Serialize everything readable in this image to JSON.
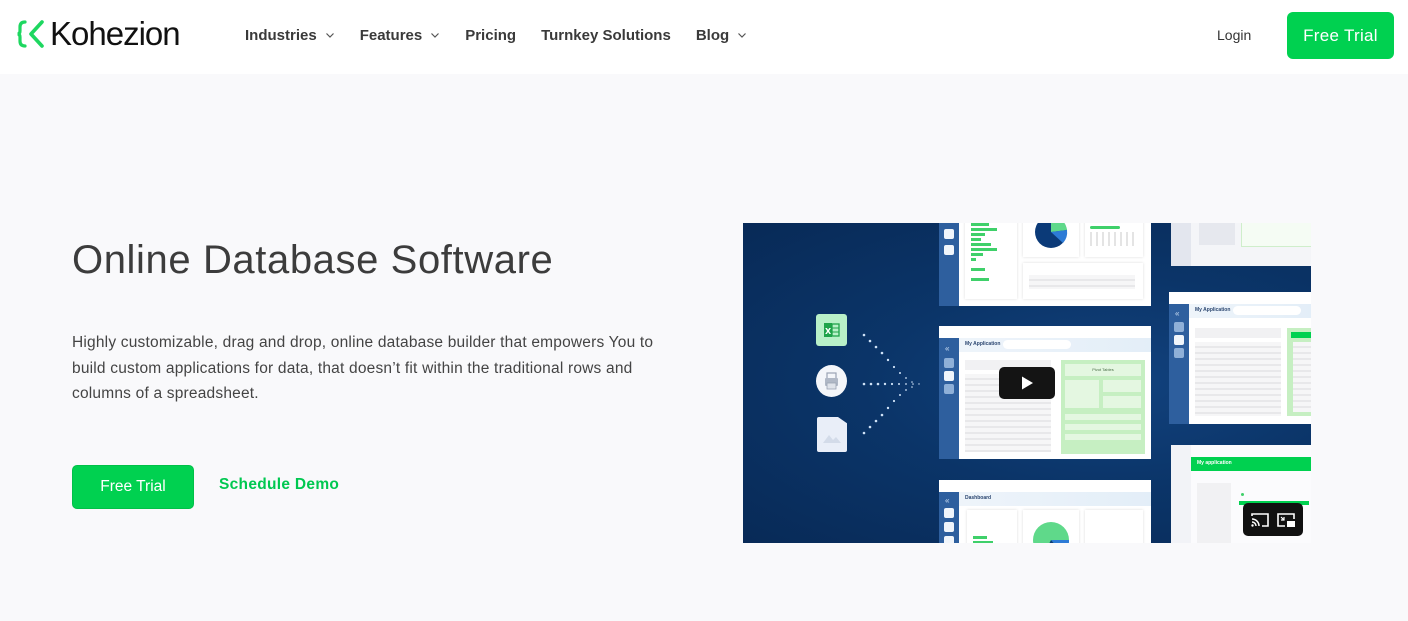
{
  "header": {
    "brand": "Kohezion",
    "nav": [
      {
        "label": "Industries",
        "has_dropdown": true
      },
      {
        "label": "Features",
        "has_dropdown": true
      },
      {
        "label": "Pricing",
        "has_dropdown": false
      },
      {
        "label": "Turnkey Solutions",
        "has_dropdown": false
      },
      {
        "label": "Blog",
        "has_dropdown": true
      }
    ],
    "login_label": "Login",
    "cta_label": "Free Trial"
  },
  "hero": {
    "title": "Online Database Software",
    "description": "Highly customizable, drag and drop, online database builder that empowers You to build custom applications for data, that doesn’t fit within the traditional rows and columns of a spreadsheet.",
    "primary_cta": "Free Trial",
    "secondary_cta": "Schedule Demo"
  },
  "video": {
    "thumbnail_labels": {
      "app_title": "My Application",
      "pivot_label": "Pivot Tables",
      "green_app_title": "My application",
      "dashboard_label": "Dashboard"
    },
    "icons": {
      "play": "play-icon",
      "cast": "cast-icon",
      "pip": "picture-in-picture-icon",
      "sources": [
        "excel-file-icon",
        "printer-document-icon",
        "image-file-icon"
      ]
    }
  },
  "colors": {
    "brand_green": "#00d150",
    "link_green": "#00c850",
    "text_dark": "#3c3c3c",
    "video_bg": "#0b3569",
    "page_bg": "#f9f9fb"
  }
}
